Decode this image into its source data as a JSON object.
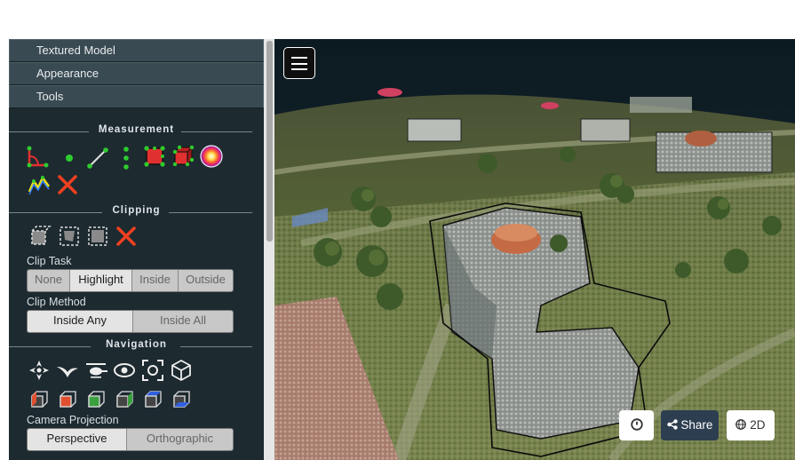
{
  "sidebar": {
    "accordions": [
      {
        "label": "Textured Model"
      },
      {
        "label": "Appearance"
      },
      {
        "label": "Tools"
      }
    ],
    "measurement": {
      "title": "Measurement"
    },
    "clipping": {
      "title": "Clipping",
      "clip_task": {
        "label": "Clip Task",
        "options": [
          "None",
          "Highlight",
          "Inside",
          "Outside"
        ],
        "selected": "Highlight"
      },
      "clip_method": {
        "label": "Clip Method",
        "options": [
          "Inside Any",
          "Inside All"
        ],
        "selected": "Inside Any"
      }
    },
    "navigation": {
      "title": "Navigation",
      "camera_projection": {
        "label": "Camera Projection",
        "options": [
          "Perspective",
          "Orthographic"
        ],
        "selected": "Perspective"
      }
    }
  },
  "viewer": {
    "share_label": "Share",
    "view_2d_label": "2D"
  },
  "colors": {
    "sidebar_bg": "#1d2a30",
    "accordion_bg": "#394a52",
    "share_bg": "#2c3e50"
  }
}
